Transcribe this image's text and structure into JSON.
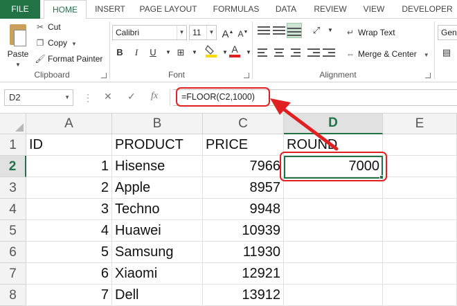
{
  "tabs": [
    "FILE",
    "HOME",
    "INSERT",
    "PAGE LAYOUT",
    "FORMULAS",
    "DATA",
    "REVIEW",
    "VIEW",
    "DEVELOPER"
  ],
  "ribbon": {
    "clipboard": {
      "paste": "Paste",
      "cut": "Cut",
      "copy": "Copy",
      "format_painter": "Format Painter",
      "label": "Clipboard"
    },
    "font": {
      "name": "Calibri",
      "size": "11",
      "bold": "B",
      "italic": "I",
      "underline": "U",
      "font_color_letter": "A",
      "label": "Font"
    },
    "alignment": {
      "wrap_text": "Wrap Text",
      "merge_center": "Merge & Center",
      "label": "Alignment"
    },
    "number": {
      "format": "Gene"
    }
  },
  "formula_bar": {
    "name_box": "D2",
    "fx": "fx",
    "formula": "=FLOOR(C2,1000)"
  },
  "columns": [
    "A",
    "B",
    "C",
    "D",
    "E"
  ],
  "selected_column": "D",
  "selected_row": "2",
  "rows": [
    {
      "num": "1",
      "A": "ID",
      "B": "PRODUCT",
      "C": "PRICE",
      "D": "ROUND"
    },
    {
      "num": "2",
      "A": "1",
      "B": "Hisense",
      "C": "7966",
      "D": "7000"
    },
    {
      "num": "3",
      "A": "2",
      "B": "Apple",
      "C": "8957",
      "D": ""
    },
    {
      "num": "4",
      "A": "3",
      "B": "Techno",
      "C": "9948",
      "D": ""
    },
    {
      "num": "5",
      "A": "4",
      "B": "Huawei",
      "C": "10939",
      "D": ""
    },
    {
      "num": "6",
      "A": "5",
      "B": "Samsung",
      "C": "11930",
      "D": ""
    },
    {
      "num": "7",
      "A": "6",
      "B": "Xiaomi",
      "C": "12921",
      "D": ""
    },
    {
      "num": "8",
      "A": "7",
      "B": "Dell",
      "C": "13912",
      "D": ""
    }
  ],
  "colors": {
    "excel_green": "#217346",
    "annotation_red": "#e02020"
  }
}
